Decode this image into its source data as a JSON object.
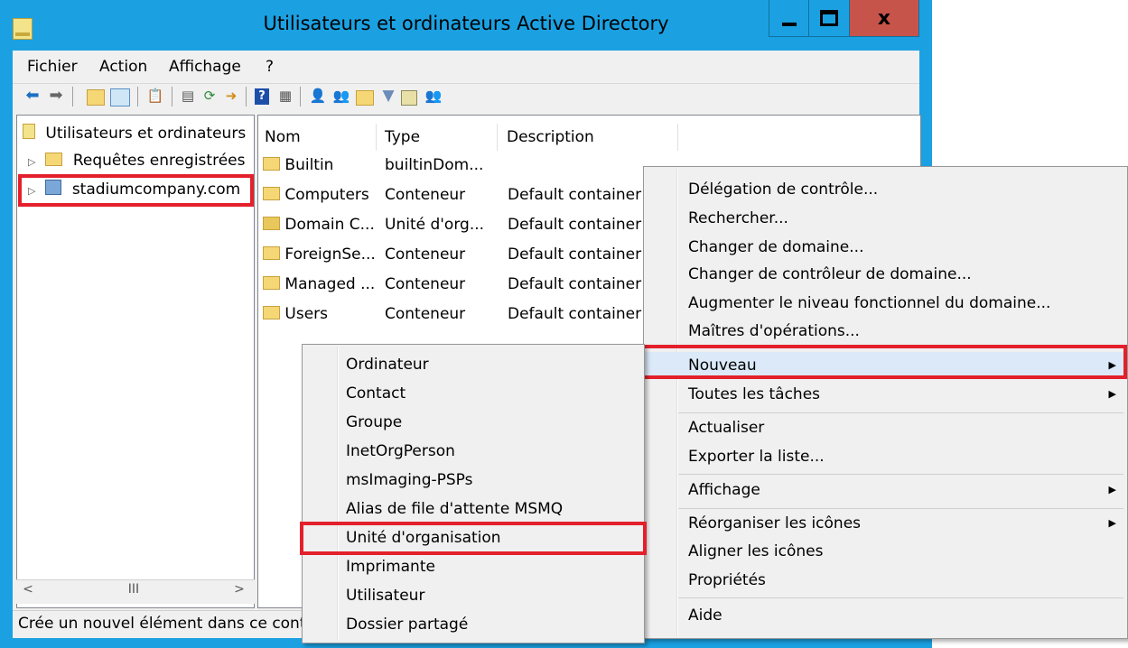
{
  "window": {
    "title": "Utilisateurs et ordinateurs Active Directory",
    "close_label": "x"
  },
  "menubar": [
    "Fichier",
    "Action",
    "Affichage",
    "?"
  ],
  "tree": {
    "root": "Utilisateurs et ordinateurs",
    "items": [
      {
        "label": "Requêtes enregistrées"
      },
      {
        "label": "stadiumcompany.com"
      }
    ],
    "scroll_mid": "III"
  },
  "list": {
    "columns": [
      "Nom",
      "Type",
      "Description"
    ],
    "rows": [
      {
        "name": "Builtin",
        "type": "builtinDom...",
        "description": ""
      },
      {
        "name": "Computers",
        "type": "Conteneur",
        "description": "Default container"
      },
      {
        "name": "Domain C...",
        "type": "Unité d'org...",
        "description": "Default container"
      },
      {
        "name": "ForeignSe...",
        "type": "Conteneur",
        "description": "Default container"
      },
      {
        "name": "Managed ...",
        "type": "Conteneur",
        "description": "Default container"
      },
      {
        "name": "Users",
        "type": "Conteneur",
        "description": "Default container"
      }
    ]
  },
  "status": "Crée un nouvel élément dans ce conteneur",
  "context_menu": {
    "items": [
      "Délégation de contrôle...",
      "Rechercher...",
      "Changer de domaine...",
      "Changer de contrôleur de domaine...",
      "Augmenter le niveau fonctionnel du domaine...",
      "Maîtres d'opérations...",
      "Nouveau",
      "Toutes les tâches",
      "Actualiser",
      "Exporter la liste...",
      "Affichage",
      "Réorganiser les icônes",
      "Aligner les icônes",
      "Propriétés",
      "Aide"
    ]
  },
  "submenu": {
    "items": [
      "Ordinateur",
      "Contact",
      "Groupe",
      "InetOrgPerson",
      "msImaging-PSPs",
      "Alias de file d'attente MSMQ",
      "Unité d'organisation",
      "Imprimante",
      "Utilisateur",
      "Dossier partagé"
    ]
  },
  "colors": {
    "titlebar": "#1ba1e2",
    "highlight_border": "#e3202b",
    "selected_item": "#dbe9f8"
  }
}
